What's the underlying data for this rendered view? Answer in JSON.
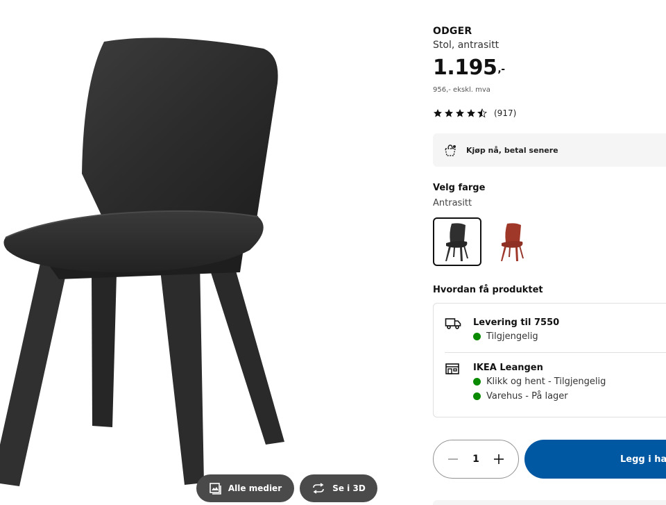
{
  "product": {
    "name": "ODGER",
    "description": "Stol, antrasitt",
    "price": "1.195",
    "price_suffix": ",-",
    "price_ex_vat": "956,- ekskl. mva",
    "rating": 4.5,
    "review_count": "(917)"
  },
  "media": {
    "all_media_label": "Alle medier",
    "view_3d_label": "Se i 3D"
  },
  "financing": {
    "label": "Kjøp nå, betal senere"
  },
  "color": {
    "heading": "Velg farge",
    "selected": "Antrasitt",
    "options": [
      {
        "name": "Antrasitt",
        "hex": "#2f2f2f",
        "selected": true
      },
      {
        "name": "Rød",
        "hex": "#a0382a",
        "selected": false
      }
    ]
  },
  "delivery": {
    "heading": "Hvordan få produktet",
    "home_delivery": {
      "title": "Levering til 7550",
      "status": "Tilgjengelig"
    },
    "store": {
      "title": "IKEA Leangen",
      "click_collect": "Klikk og hent - Tilgjengelig",
      "in_store": "Varehus - På lager"
    },
    "status_color": "#0a8a00"
  },
  "cart": {
    "quantity": "1",
    "add_label": "Legg i handlekurv"
  },
  "colors": {
    "accent": "#0058a3",
    "media_button": "#4a4a4a"
  }
}
